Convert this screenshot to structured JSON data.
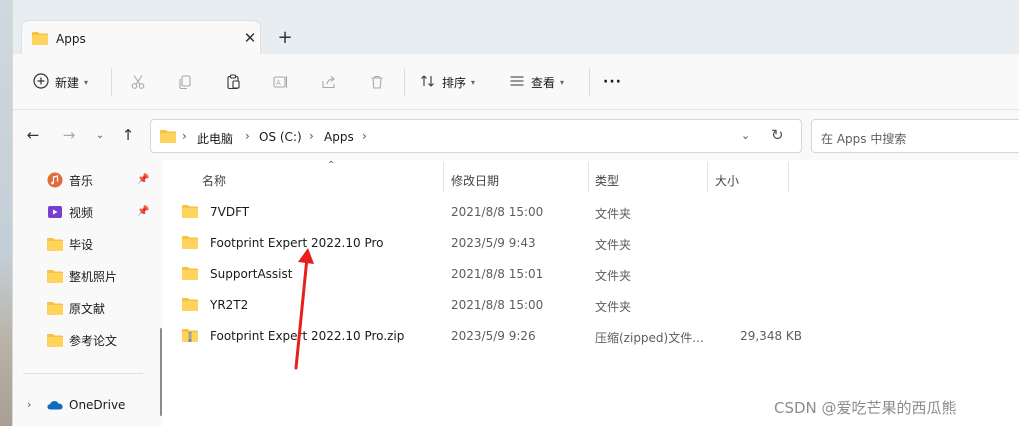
{
  "window": {
    "tab_title": "Apps",
    "tab_close": "✕",
    "new_tab": "+"
  },
  "toolbar": {
    "new_label": "新建",
    "sort_label": "排序",
    "view_label": "查看",
    "more": "···"
  },
  "nav": {
    "crumbs": [
      "此电脑",
      "OS (C:)",
      "Apps"
    ],
    "search_placeholder": "在 Apps 中搜索"
  },
  "sidebar": {
    "items": [
      {
        "label": "音乐",
        "icon": "music-icon",
        "pinned": true
      },
      {
        "label": "视频",
        "icon": "video-icon",
        "pinned": true
      },
      {
        "label": "毕设",
        "icon": "folder-icon",
        "pinned": false
      },
      {
        "label": "整机照片",
        "icon": "folder-icon",
        "pinned": false
      },
      {
        "label": "原文献",
        "icon": "folder-icon",
        "pinned": false
      },
      {
        "label": "参考论文",
        "icon": "folder-icon",
        "pinned": false
      }
    ],
    "onedrive_label": "OneDrive"
  },
  "columns": {
    "name": "名称",
    "date": "修改日期",
    "type": "类型",
    "size": "大小"
  },
  "files": [
    {
      "name": "7VDFT",
      "date": "2021/8/8 15:00",
      "type": "文件夹",
      "size": "",
      "kind": "folder"
    },
    {
      "name": "Footprint Expert 2022.10 Pro",
      "date": "2023/5/9 9:43",
      "type": "文件夹",
      "size": "",
      "kind": "folder"
    },
    {
      "name": "SupportAssist",
      "date": "2021/8/8 15:01",
      "type": "文件夹",
      "size": "",
      "kind": "folder"
    },
    {
      "name": "YR2T2",
      "date": "2021/8/8 15:00",
      "type": "文件夹",
      "size": "",
      "kind": "folder"
    },
    {
      "name": "Footprint Expert 2022.10 Pro.zip",
      "date": "2023/5/9 9:26",
      "type": "压缩(zipped)文件...",
      "size": "29,348 KB",
      "kind": "zip"
    }
  ],
  "colors": {
    "folder": "#f5c342",
    "annotation_arrow": "#e8201c",
    "accent": "#0067c0"
  },
  "watermark": "CSDN @爱吃芒果的西瓜熊"
}
